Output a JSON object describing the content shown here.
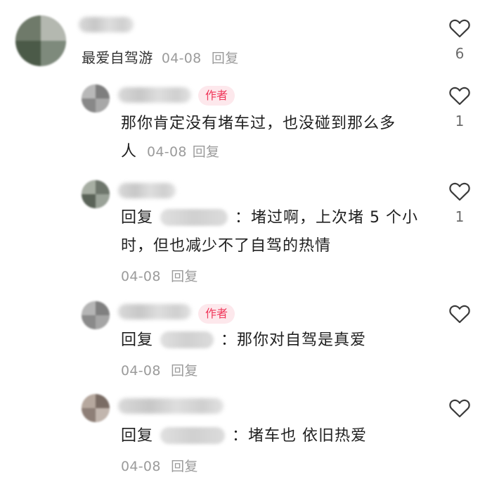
{
  "comments": [
    {
      "id": "c1",
      "username": "最爱自驾游",
      "date": "04-08",
      "reply_label": "回复",
      "like_count": "6"
    },
    {
      "id": "c2",
      "badge": "作者",
      "text_line1": "那你肯定没有堵车过，也没碰到那么多",
      "text_line2_prefix": "人",
      "date": "04-08",
      "reply_label": "回复",
      "like_count": "1"
    },
    {
      "id": "c3",
      "reply_prefix": "回复",
      "text_after_mention": "：堵过啊，上次堵 5 个小",
      "text_line2": "时，但也减少不了自驾的热情",
      "date": "04-08",
      "reply_label": "回复",
      "like_count": "1"
    },
    {
      "id": "c4",
      "badge": "作者",
      "reply_prefix": "回复",
      "text_after_mention": "：那你对自驾是真爱",
      "date": "04-08",
      "reply_label": "回复",
      "like_count": ""
    },
    {
      "id": "c5",
      "reply_prefix": "回复",
      "text_after_mention": "：堵车也 依旧热爱",
      "date": "04-08",
      "reply_label": "回复",
      "like_count": ""
    }
  ],
  "icons": {
    "like": "heart-outline-icon"
  },
  "colors": {
    "author_badge_bg": "#fde8ec",
    "author_badge_text": "#f0375a",
    "meta_text": "#9b9b9b"
  }
}
